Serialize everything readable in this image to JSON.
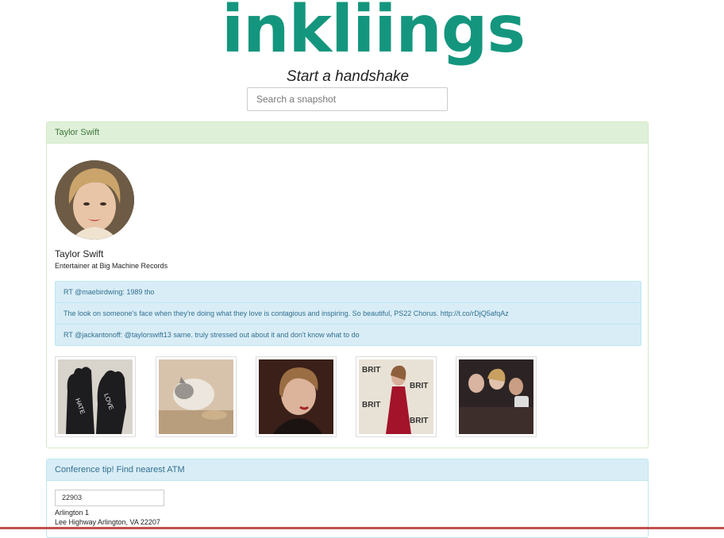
{
  "brand": {
    "logo_text": "inkliings",
    "tagline": "Start a handshake"
  },
  "search": {
    "placeholder": "Search a snapshot"
  },
  "profile": {
    "heading": "Taylor Swift",
    "name": "Taylor Swift",
    "title": "Entertainer at Big Machine Records",
    "tweets": [
      "RT @maebirdwing: 1989 tho",
      "The look on someone's face when they're doing what they love is contagious and inspiring. So beautiful, PS22 Chorus. http://t.co/rDjQ5afqAz",
      "RT @jackantonoff: @taylorswift13 same. truly stressed out about it and don't know what to do"
    ],
    "photos": [
      "gloves-photo",
      "cat-photo",
      "portrait-photo",
      "brit-awards-photo",
      "crowd-selfie-photo"
    ]
  },
  "atm": {
    "heading": "Conference tip! Find nearest ATM",
    "zip": "22903",
    "name": "Arlington 1",
    "address": "Lee Highway Arlington, VA 22207"
  },
  "colors": {
    "brand": "#14967e",
    "success_bg": "#dff0d8",
    "info_bg": "#d9edf7"
  }
}
